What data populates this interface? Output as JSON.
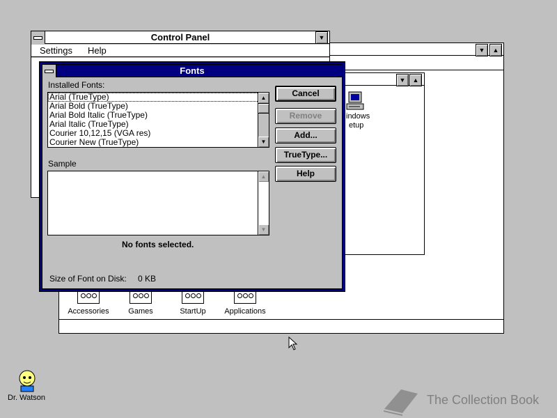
{
  "control_panel": {
    "title": "Control Panel",
    "menu": [
      {
        "label": "Settings"
      },
      {
        "label": "Help"
      }
    ]
  },
  "program_manager": {
    "groups": [
      {
        "label": "Accessories"
      },
      {
        "label": "Games"
      },
      {
        "label": "StartUp"
      },
      {
        "label": "Applications"
      }
    ],
    "partial_icon_label_line1": "indows",
    "partial_icon_label_line2": "etup"
  },
  "fonts_dialog": {
    "title": "Fonts",
    "installed_fonts_label": "Installed Fonts:",
    "installed_fonts": [
      "Arial (TrueType)",
      "Arial Bold (TrueType)",
      "Arial Bold Italic (TrueType)",
      "Arial Italic (TrueType)",
      "Courier 10,12,15 (VGA res)",
      "Courier New (TrueType)"
    ],
    "sample_label": "Sample",
    "status_text": "No fonts selected.",
    "size_label": "Size of Font on Disk:",
    "size_value": "0 KB",
    "buttons": {
      "cancel": "Cancel",
      "remove": "Remove",
      "add": "Add...",
      "truetype": "TrueType...",
      "help": "Help"
    }
  },
  "desktop": {
    "dr_watson_label": "Dr. Watson",
    "watermark_text": "The Collection Book"
  }
}
